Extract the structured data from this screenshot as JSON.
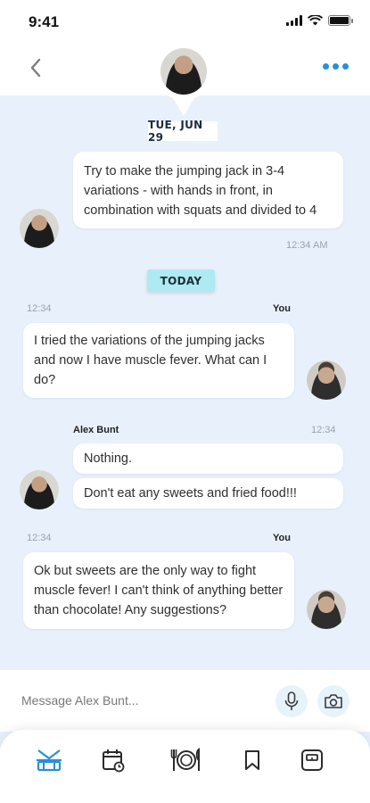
{
  "status_bar": {
    "time": "9:41"
  },
  "header": {
    "contact": "Alex Bunt"
  },
  "chat": {
    "date_chip": "TUE, JUN 29",
    "today_chip": "TODAY",
    "messages": [
      {
        "from": "Alex Bunt",
        "text": "Try to make the jumping jack in 3-4 variations - with hands in front, in combination with squats and divided to 4",
        "time": "12:34 AM"
      },
      {
        "from": "You",
        "sender_label": "You",
        "time": "12:34",
        "text": "I tried the variations of the jumping jacks and now I have muscle fever. What can I do?"
      },
      {
        "from": "Alex Bunt",
        "sender_label": "Alex Bunt",
        "time": "12:34",
        "texts": [
          "Nothing.",
          "Don't eat any sweets and fried food!!!"
        ]
      },
      {
        "from": "You",
        "sender_label": "You",
        "time": "12:34",
        "text": "Ok but sweets are the only way to fight muscle fever! I can't think of anything better than chocolate! Any suggestions?"
      }
    ]
  },
  "composer": {
    "placeholder": "Message Alex Bunt..."
  },
  "icons": {
    "back": "chevron-left-icon",
    "more": "more-dots-icon",
    "mic": "microphone-icon",
    "camera": "camera-icon",
    "nav": [
      "workout-icon",
      "calendar-icon",
      "meal-icon",
      "bookmark-icon",
      "scale-icon"
    ]
  },
  "colors": {
    "accent": "#2a8fd8",
    "background": "#e8f1fb",
    "today_chip": "#aeeaf1"
  }
}
